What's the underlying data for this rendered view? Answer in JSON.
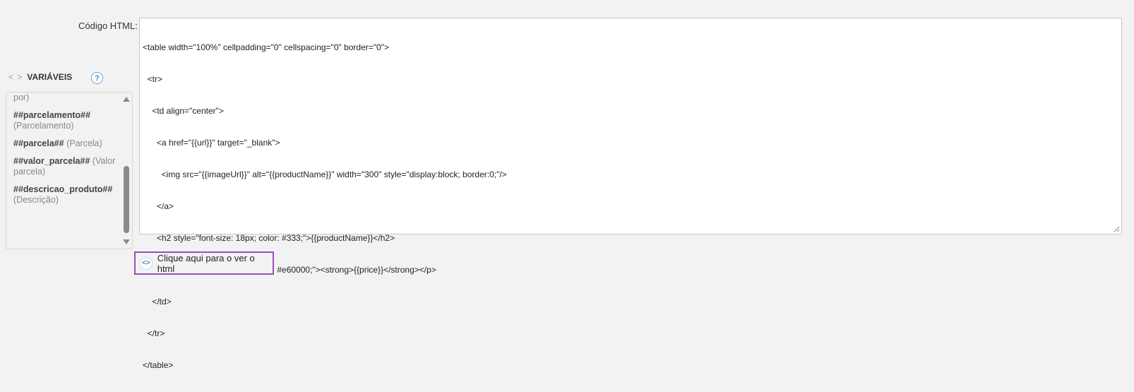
{
  "field": {
    "label": "Código HTML:"
  },
  "code": {
    "lines": [
      "<table width=\"100%\" cellpadding=\"0\" cellspacing=\"0\" border=\"0\">",
      "  <tr>",
      "    <td align=\"center\">",
      "      <a href=\"{{url}}\" target=\"_blank\">",
      "        <img src=\"{{imageUrl}}\" alt=\"{{productName}}\" width=\"300\" style=\"display:block; border:0;\"/>",
      "      </a>",
      "      <h2 style=\"font-size: 18px; color: #333;\">{{productName}}</h2>",
      "      <p style=\"font-size: 16px; color: #e60000;\"><strong>{{price}}</strong></p>",
      "    </td>",
      "  </tr>",
      "</table>"
    ]
  },
  "variables": {
    "arrows": "< >",
    "title": "VARIÁVEIS",
    "help_icon": "?",
    "items": [
      {
        "key": "",
        "desc": "por)"
      },
      {
        "key": "##parcelamento##",
        "desc": "(Parcelamento)"
      },
      {
        "key": "##parcela##",
        "desc": "(Parcela)"
      },
      {
        "key": "##valor_parcela##",
        "desc": "(Valor parcela)"
      },
      {
        "key": "##descricao_produto##",
        "desc": "(Descrição)"
      }
    ]
  },
  "view_button": {
    "icon": "<>",
    "label": "Clique aqui para o ver o html"
  },
  "colors": {
    "button_border": "#9b4fb8",
    "accent": "#3b8bd1",
    "spell_underline": "#e02020"
  }
}
